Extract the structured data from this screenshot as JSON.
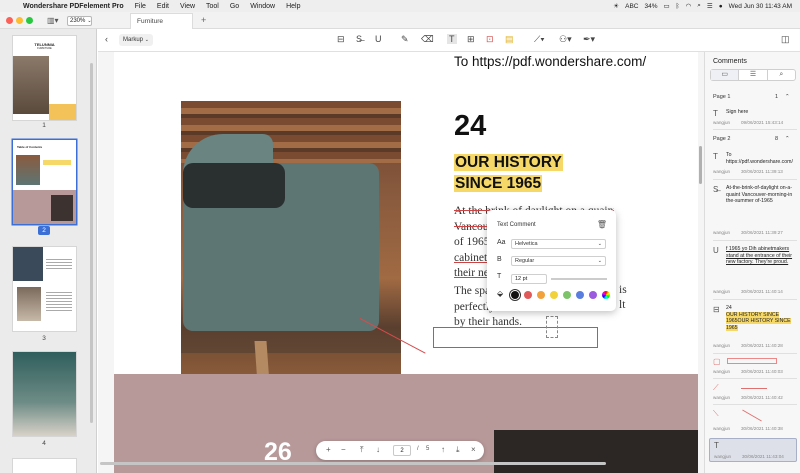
{
  "menubar": {
    "apple": "",
    "app": "Wondershare PDFelement Pro",
    "items": [
      "File",
      "Edit",
      "View",
      "Tool",
      "Go",
      "Window",
      "Help"
    ],
    "status_battery": "34%",
    "input": "ABC",
    "clock": "Wed Jun 30  11:43 AM"
  },
  "window": {
    "zoom": "230%",
    "tab": "Furniture",
    "add_tab": "+"
  },
  "sidebar": {
    "pages": [
      "1",
      "2",
      "3",
      "4"
    ],
    "selected": "2",
    "thumb1_title": "TELUNNIA",
    "thumb1_sub": "FURNITURE",
    "thumb2_title": "Table of Contents"
  },
  "toolbar": {
    "mode": "Markup"
  },
  "doc": {
    "url_text": "To https://pdf.wondershare.com/",
    "big_number": "24",
    "history_line1": "OUR HISTORY",
    "history_line2": "SINCE 1965",
    "para1": [
      "At the brink of daylight on a quaint",
      "Vancouv",
      "of 1965,",
      "cabinetm",
      "their ne"
    ],
    "para2": [
      "The spac",
      "perfectly",
      "by their hands."
    ],
    "frag_is": "is",
    "frag_lt": "lt",
    "next_number": "26"
  },
  "popup": {
    "title": "Text Comment",
    "font_label": "Aa",
    "font": "Helvetica",
    "style_label": "B",
    "style": "Regular",
    "size_label": "T",
    "size": "12 pt",
    "colors": [
      "#111111",
      "#e05a5a",
      "#f2a23a",
      "#f2d23a",
      "#7cc36a",
      "#5a7de0",
      "#9b5ae0",
      "#e07ad0"
    ]
  },
  "pagenav": {
    "current": "2",
    "sep": "/",
    "total": "5"
  },
  "comments": {
    "title": "Comments",
    "page1": {
      "label": "Page 1",
      "count": "1"
    },
    "page2": {
      "label": "Page 2",
      "count": "8"
    },
    "items": [
      {
        "icon": "T",
        "text": "Sign here",
        "user": "wangjun",
        "date": "09/06/2021 15:43:14"
      },
      {
        "icon": "T",
        "text": "To https://pdf.wondershare.com/",
        "user": "wangjun",
        "date": "30/06/2021 11:39:13"
      },
      {
        "icon": "S",
        "text": "At-the-brink-of-daylight on-a-quaint Vancouver-morning-in the-summer of-1965",
        "user": "wangjun",
        "date": "30/06/2021 11:39:27"
      },
      {
        "icon": "U",
        "text": "f 1965 yo Dih abinetmakers stand at the entrance of their new factory. They're proud.",
        "user": "wangjun",
        "date": "30/06/2021 11:40:14"
      },
      {
        "icon": "T",
        "text": "24",
        "hl": "OUR HISTORY SINCE 1965OUR HISTORY SINCE 1965",
        "user": "wangjun",
        "date": "30/06/2021 11:40:28"
      },
      {
        "icon": "rect",
        "user": "wangjun",
        "date": "30/06/2021 11:40:03"
      },
      {
        "icon": "line",
        "user": "wangjun",
        "date": "30/06/2021 11:40:42"
      },
      {
        "icon": "line2",
        "user": "wangjun",
        "date": "30/06/2021 11:40:38"
      },
      {
        "icon": "T",
        "user": "wangjun",
        "date": "30/06/2021 11:43:04"
      }
    ]
  }
}
